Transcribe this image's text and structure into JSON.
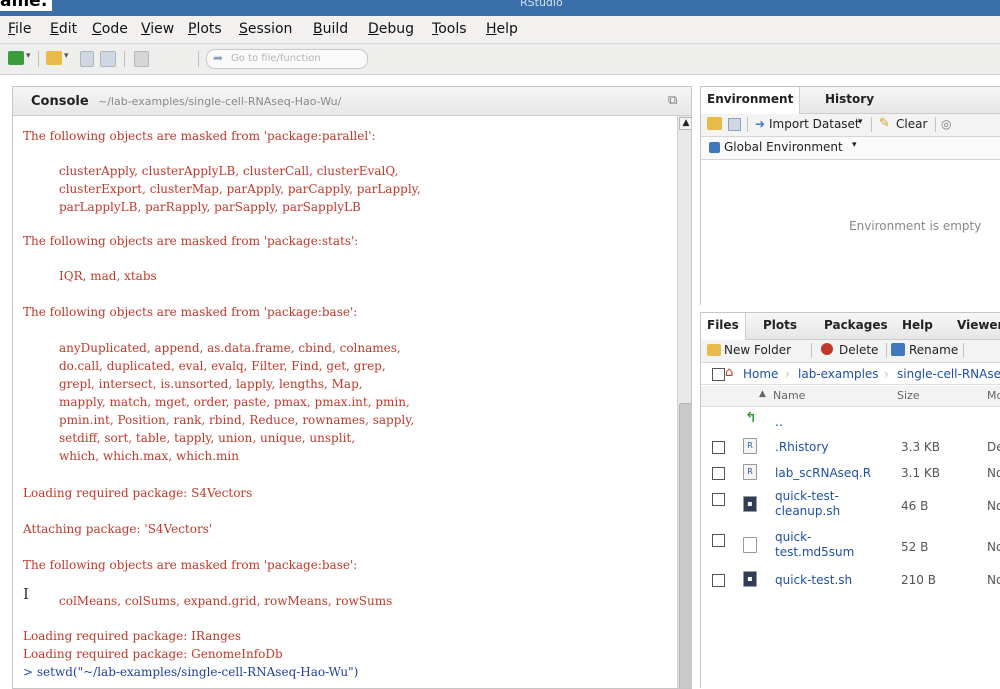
{
  "window": {
    "title_fragment": "RStudio",
    "corner_text": "ame:"
  },
  "menu": [
    "File",
    "Edit",
    "Code",
    "View",
    "Plots",
    "Session",
    "Build",
    "Debug",
    "Tools",
    "Help"
  ],
  "toolbar": {
    "goto_placeholder": "Go to file/function"
  },
  "console": {
    "title": "Console",
    "path": "~/lab-examples/single-cell-RNAseq-Hao-Wu/",
    "lines": [
      "The following objects are masked from 'package:parallel':",
      "clusterApply, clusterApplyLB, clusterCall, clusterEvalQ,",
      "clusterExport, clusterMap, parApply, parCapply, parLapply,",
      "parLapplyLB, parRapply, parSapply, parSapplyLB",
      "The following objects are masked from 'package:stats':",
      "IQR, mad, xtabs",
      "The following objects are masked from 'package:base':",
      "anyDuplicated, append, as.data.frame, cbind, colnames,",
      "do.call, duplicated, eval, evalq, Filter, Find, get, grep,",
      "grepl, intersect, is.unsorted, lapply, lengths, Map,",
      "mapply, match, mget, order, paste, pmax, pmax.int, pmin,",
      "pmin.int, Position, rank, rbind, Reduce, rownames, sapply,",
      "setdiff, sort, table, tapply, union, unique, unsplit,",
      "which, which.max, which.min",
      "Loading required package: S4Vectors",
      "Attaching package: 'S4Vectors'",
      "The following objects are masked from 'package:base':",
      "colMeans, colSums, expand.grid, rowMeans, rowSums",
      "Loading required package: IRanges",
      "Loading required package: GenomeInfoDb",
      "> setwd(\"~/lab-examples/single-cell-RNAseq-Hao-Wu\")"
    ]
  },
  "environment": {
    "tabs": [
      "Environment",
      "History"
    ],
    "import_label": "Import Dataset",
    "clear_label": "Clear",
    "scope_label": "Global Environment",
    "empty_message": "Environment is empty"
  },
  "files": {
    "tabs": [
      "Files",
      "Plots",
      "Packages",
      "Help",
      "Viewer"
    ],
    "new_folder_label": "New Folder",
    "delete_label": "Delete",
    "rename_label": "Rename",
    "breadcrumb": [
      "Home",
      "lab-examples",
      "single-cell-RNAseq-Hao-Wu"
    ],
    "col_name": "Name",
    "col_size": "Size",
    "col_modified": "Modified",
    "parent_label": "..",
    "rows": [
      {
        "name": ".Rhistory",
        "size": "3.3 KB",
        "modified": "De"
      },
      {
        "name": "lab_scRNAseq.R",
        "size": "3.1 KB",
        "modified": "No"
      },
      {
        "name": "quick-test-cleanup.sh",
        "name_line1": "quick-test-",
        "name_line2": "cleanup.sh",
        "size": "46 B",
        "modified": "No"
      },
      {
        "name": "quick-test.md5sum",
        "name_line1": "quick-",
        "name_line2": "test.md5sum",
        "size": "52 B",
        "modified": "No"
      },
      {
        "name": "quick-test.sh",
        "size": "210 B",
        "modified": "No"
      }
    ]
  },
  "colors": {
    "console_text": "#c0392b",
    "command_text": "#1f3fa6",
    "link": "#1f4fa8",
    "titlebar": "#3b6faa"
  }
}
